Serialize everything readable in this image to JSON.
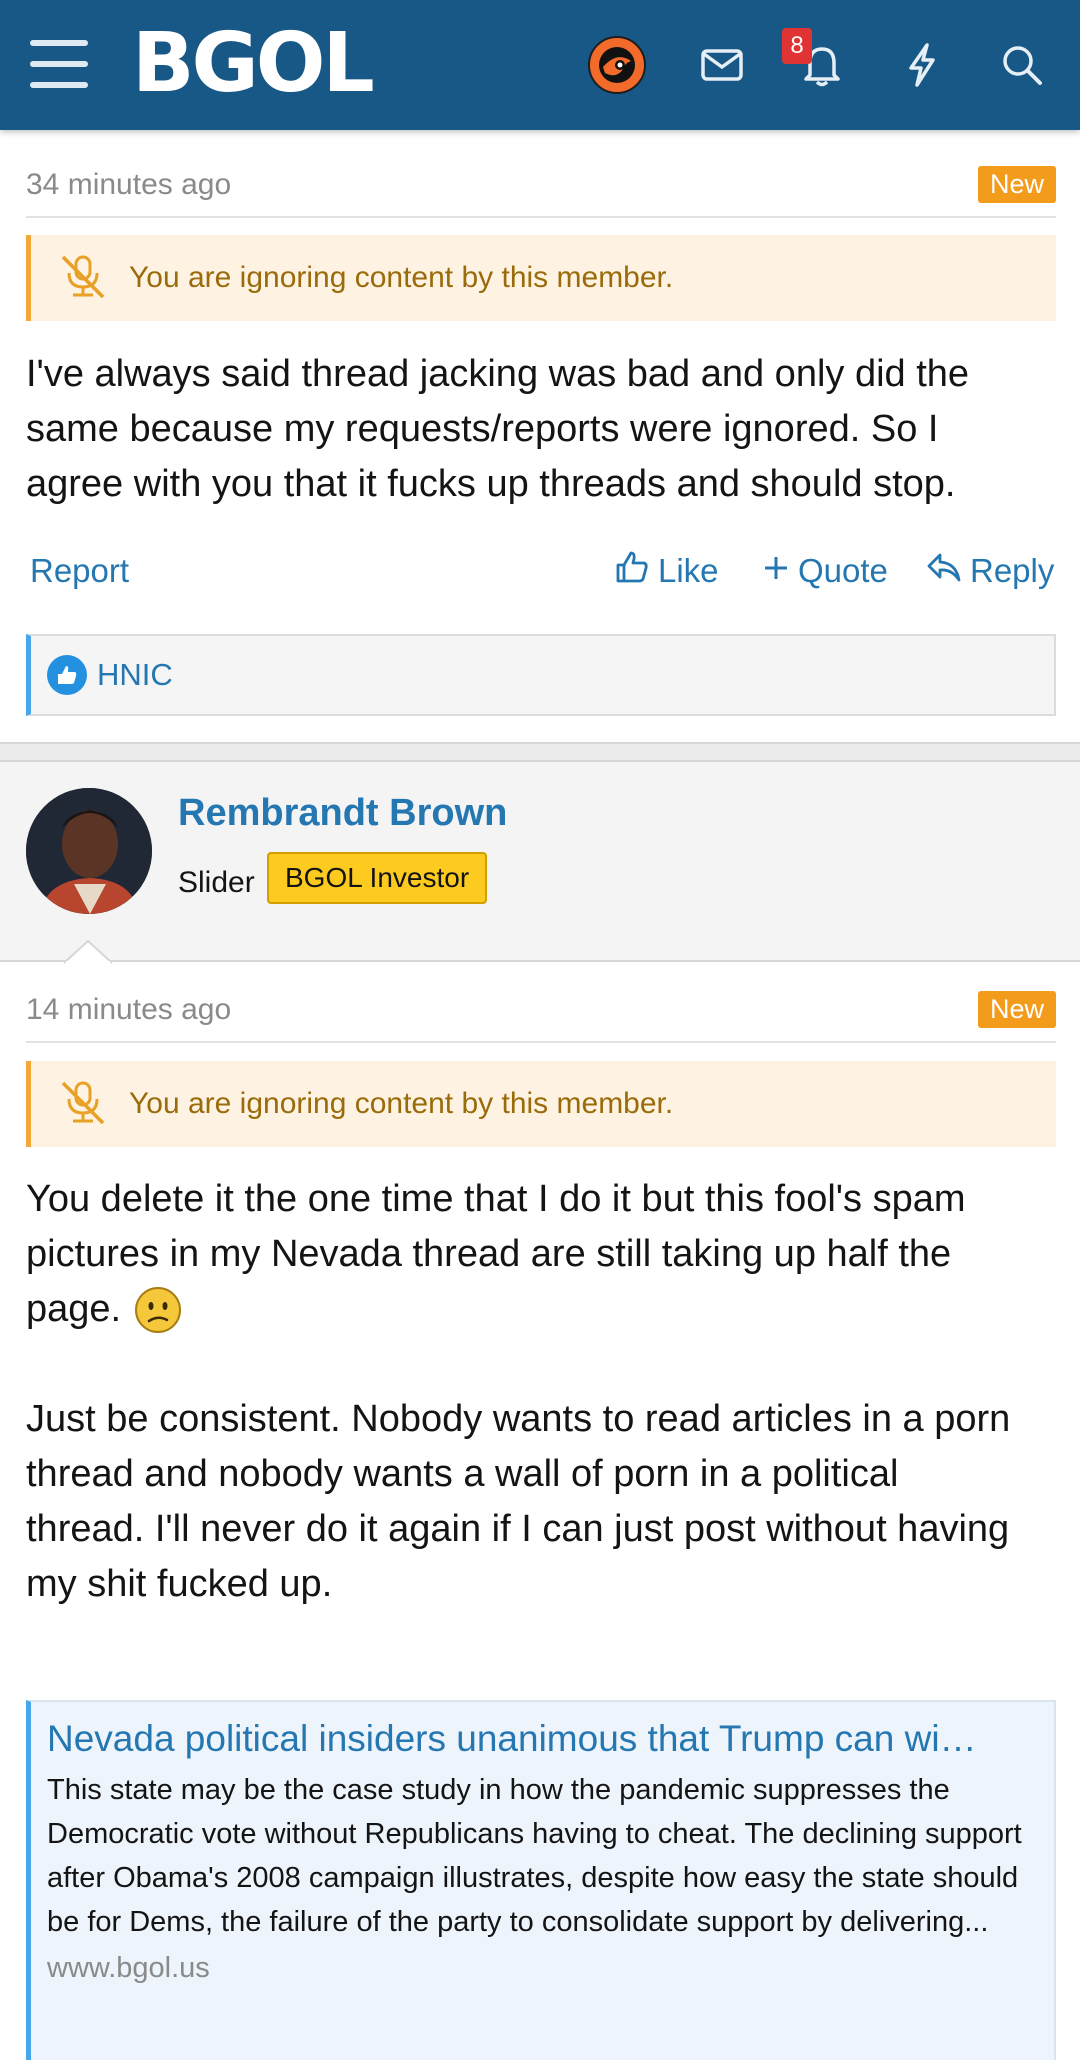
{
  "header": {
    "logo": "BGOL",
    "notification_count": "8",
    "icons": [
      "menu-icon",
      "flyers-avatar",
      "mail-icon",
      "bell-icon",
      "bolt-icon",
      "search-icon"
    ],
    "colors": {
      "bar": "#185886",
      "badge": "#e03434"
    }
  },
  "post1": {
    "timestamp": "34 minutes ago",
    "new_label": "New",
    "ignore_notice": "You are ignoring content by this member.",
    "body_lines": [
      "I've always said thread jacking was bad and only did the",
      "same because my requests/reports were ignored. So I",
      "agree with you that it fucks up threads and should stop."
    ],
    "actions": {
      "report": "Report",
      "like": "Like",
      "quote": "Quote",
      "reply": "Reply"
    },
    "liked_by": "HNIC"
  },
  "post2": {
    "username": "Rembrandt Brown",
    "user_title": "Slider",
    "user_banner": "BGOL Investor",
    "timestamp": "14 minutes ago",
    "new_label": "New",
    "ignore_notice": "You are ignoring content by this member.",
    "para1_lines": [
      "You delete it the one time that I do it but this fool's spam",
      "pictures in my Nevada thread are still taking up half the",
      "page."
    ],
    "para2_lines": [
      "Just be consistent. Nobody wants to read articles in a porn",
      "thread and nobody wants a wall of porn in a political",
      "thread. I'll never do it again if I can just post without having",
      "my shit fucked up."
    ],
    "unfurl": {
      "title": "Nevada political insiders unanimous that Trump can wi…",
      "description": "This state may be the case study in how the pandemic suppresses the Democratic vote without Republicans having to cheat. The declining support after Obama's 2008 campaign illustrates, despite how easy the state should be for Dems, the failure of the party to consolidate support by delivering...",
      "domain": "www.bgol.us"
    }
  }
}
